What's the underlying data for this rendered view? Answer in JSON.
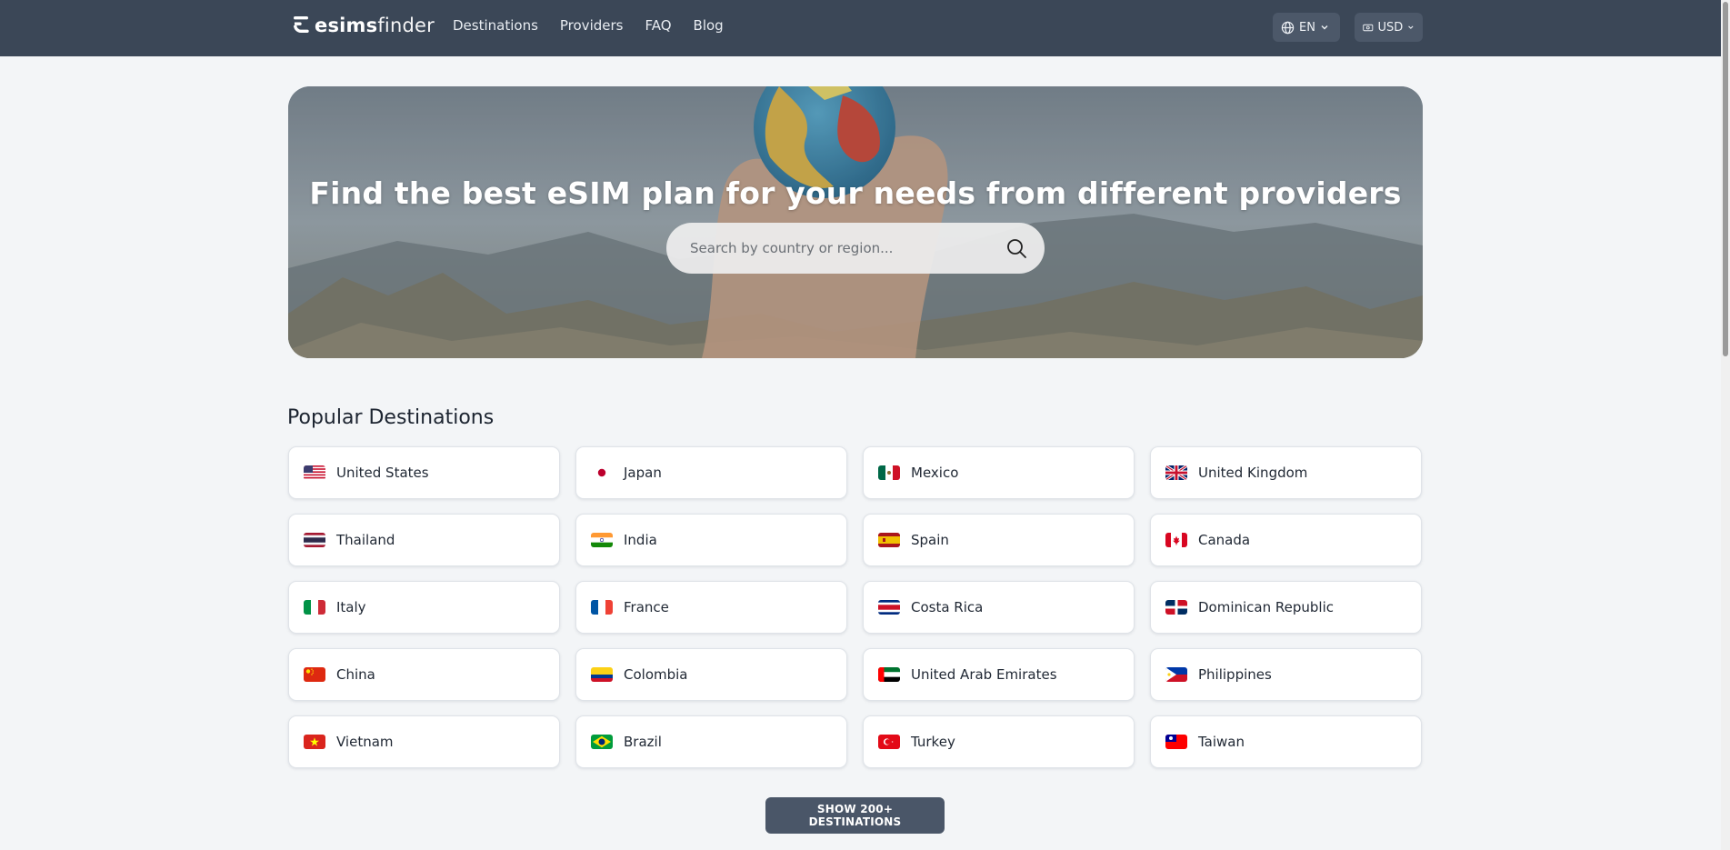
{
  "brand": {
    "name_bold": "esims",
    "name_light": "finder"
  },
  "nav": {
    "items": [
      {
        "label": "Destinations"
      },
      {
        "label": "Providers"
      },
      {
        "label": "FAQ"
      },
      {
        "label": "Blog"
      }
    ]
  },
  "language": {
    "value": "EN",
    "icon": "globe-icon"
  },
  "currency": {
    "value": "USD",
    "icon": "banknote-icon"
  },
  "hero": {
    "title": "Find the best eSIM plan for your needs from different providers",
    "search": {
      "placeholder": "Search by country or region...",
      "value": "",
      "icon": "search-icon"
    }
  },
  "popular": {
    "title": "Popular Destinations",
    "destinations": [
      {
        "name": "United States",
        "flag": "us-flag-icon"
      },
      {
        "name": "Japan",
        "flag": "japan-flag-icon"
      },
      {
        "name": "Mexico",
        "flag": "mexico-flag-icon"
      },
      {
        "name": "United Kingdom",
        "flag": "uk-flag-icon"
      },
      {
        "name": "Thailand",
        "flag": "thailand-flag-icon"
      },
      {
        "name": "India",
        "flag": "india-flag-icon"
      },
      {
        "name": "Spain",
        "flag": "spain-flag-icon"
      },
      {
        "name": "Canada",
        "flag": "canada-flag-icon"
      },
      {
        "name": "Italy",
        "flag": "italy-flag-icon"
      },
      {
        "name": "France",
        "flag": "france-flag-icon"
      },
      {
        "name": "Costa Rica",
        "flag": "costa-rica-flag-icon"
      },
      {
        "name": "Dominican Republic",
        "flag": "dominican-republic-flag-icon"
      },
      {
        "name": "China",
        "flag": "china-flag-icon"
      },
      {
        "name": "Colombia",
        "flag": "colombia-flag-icon"
      },
      {
        "name": "United Arab Emirates",
        "flag": "uae-flag-icon"
      },
      {
        "name": "Philippines",
        "flag": "philippines-flag-icon"
      },
      {
        "name": "Vietnam",
        "flag": "vietnam-flag-icon"
      },
      {
        "name": "Brazil",
        "flag": "brazil-flag-icon"
      },
      {
        "name": "Turkey",
        "flag": "turkey-flag-icon"
      },
      {
        "name": "Taiwan",
        "flag": "taiwan-flag-icon"
      }
    ],
    "show_more_label": "SHOW 200+ DESTINATIONS"
  },
  "colors": {
    "topbar": "#3b4757",
    "page_bg": "#f3f5f7",
    "button": "#4a5668",
    "card_border": "#dfe3e8"
  }
}
